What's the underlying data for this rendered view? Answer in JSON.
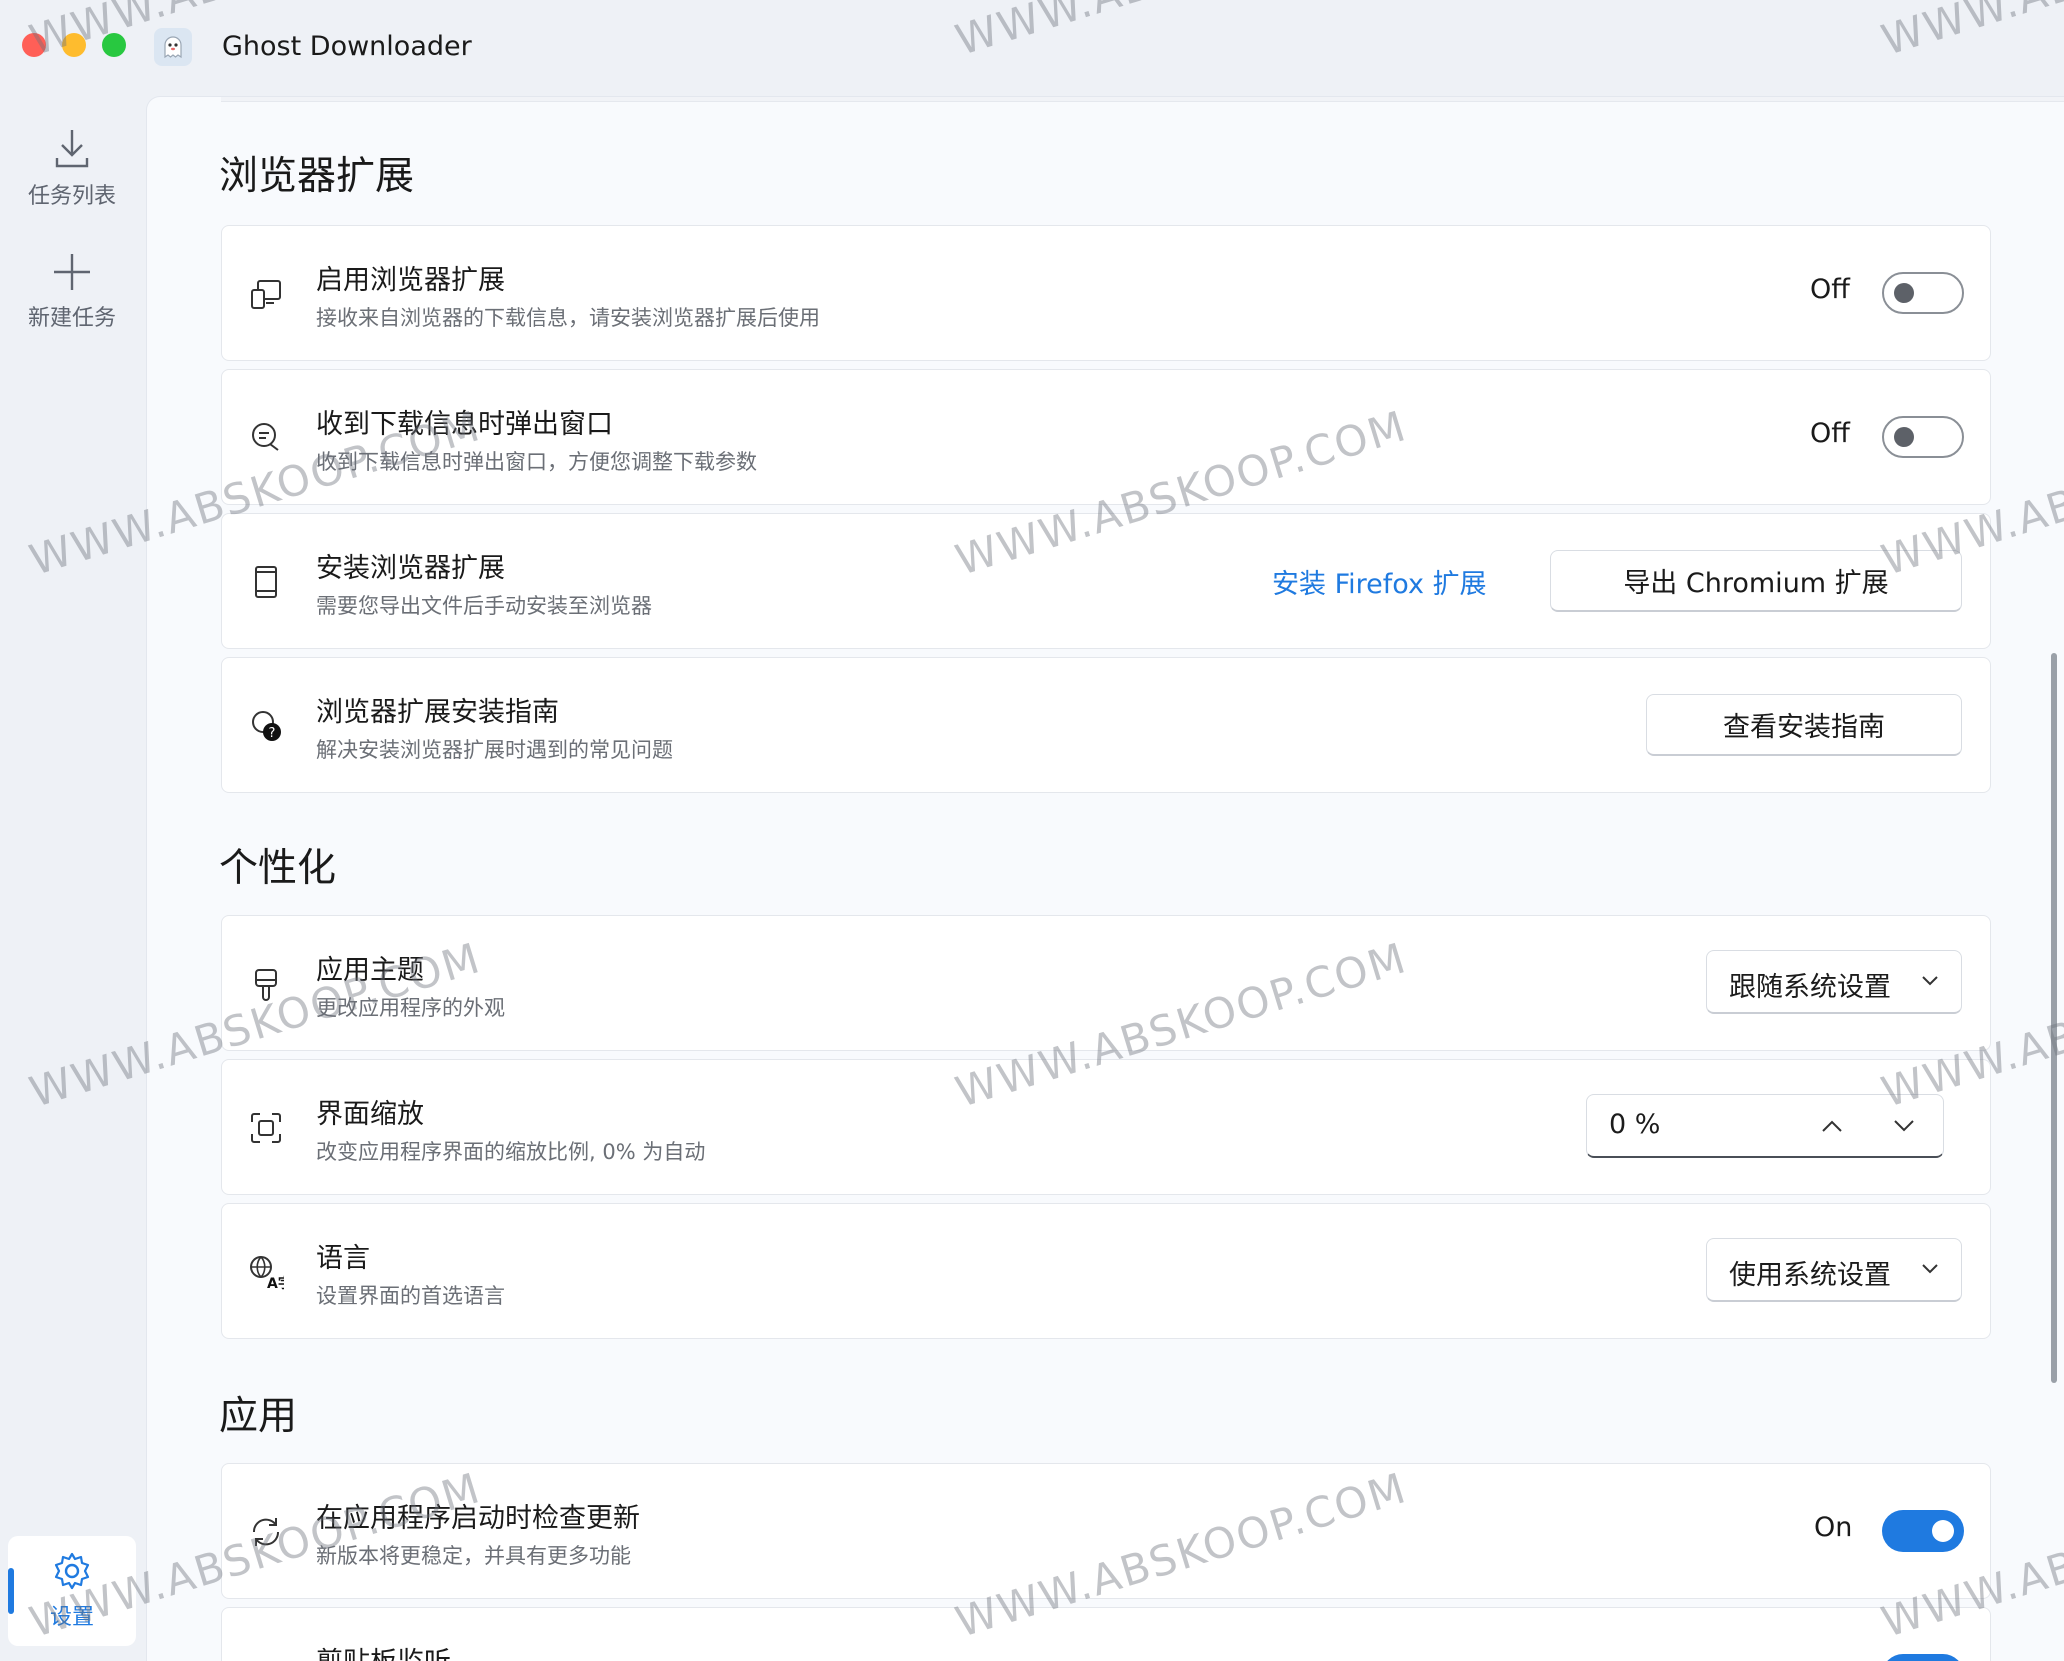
{
  "window": {
    "title": "Ghost Downloader"
  },
  "nav": {
    "tasks_label": "任务列表",
    "new_label": "新建任务",
    "settings_label": "设置"
  },
  "sections": {
    "browser": "浏览器扩展",
    "personal": "个性化",
    "app": "应用"
  },
  "browser": {
    "enable": {
      "title": "启用浏览器扩展",
      "desc": "接收来自浏览器的下载信息，请安装浏览器扩展后使用",
      "state": "Off"
    },
    "popup": {
      "title": "收到下载信息时弹出窗口",
      "desc": "收到下载信息时弹出窗口，方便您调整下载参数",
      "state": "Off"
    },
    "install": {
      "title": "安装浏览器扩展",
      "desc": "需要您导出文件后手动安装至浏览器",
      "firefox_link": "安装 Firefox 扩展",
      "chromium_button": "导出 Chromium 扩展"
    },
    "guide": {
      "title": "浏览器扩展安装指南",
      "desc": "解决安装浏览器扩展时遇到的常见问题",
      "button": "查看安装指南"
    }
  },
  "personal": {
    "theme": {
      "title": "应用主题",
      "desc": "更改应用程序的外观",
      "value": "跟随系统设置"
    },
    "zoom": {
      "title": "界面缩放",
      "desc": "改变应用程序界面的缩放比例, 0% 为自动",
      "value": "0 %"
    },
    "language": {
      "title": "语言",
      "desc": "设置界面的首选语言",
      "value": "使用系统设置"
    }
  },
  "app": {
    "update": {
      "title": "在应用程序启动时检查更新",
      "desc": "新版本将更稳定，并具有更多功能",
      "state": "On"
    },
    "clipboard": {
      "title": "剪贴板监听"
    }
  },
  "watermark": "WWW.ABSKOOP.COM",
  "colors": {
    "accent": "#1f7ae0",
    "background": "#eef1f6",
    "card": "#ffffff"
  }
}
